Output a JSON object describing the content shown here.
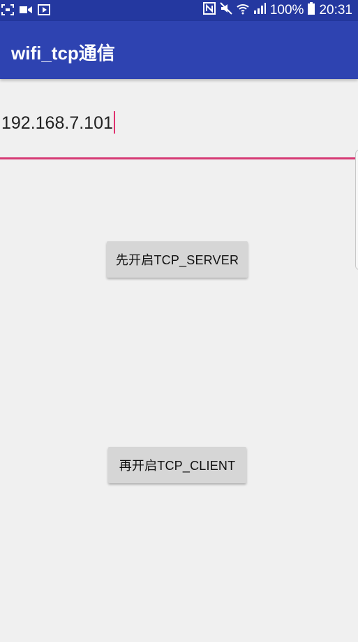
{
  "status_bar": {
    "battery": "100%",
    "time": "20:31",
    "icons": [
      "screenshot-icon",
      "video-icon",
      "media-icon",
      "nfc-icon",
      "mute-icon",
      "wifi-icon",
      "signal-icon",
      "battery-icon"
    ]
  },
  "app_bar": {
    "title": "wifi_tcp通信",
    "color": "#2e43b1"
  },
  "ip_input": {
    "value": "192.168.7.101",
    "accent": "#d63a74"
  },
  "buttons": {
    "server_label": "先开启TCP_SERVER",
    "client_label": "再开启TCP_CLIENT"
  }
}
